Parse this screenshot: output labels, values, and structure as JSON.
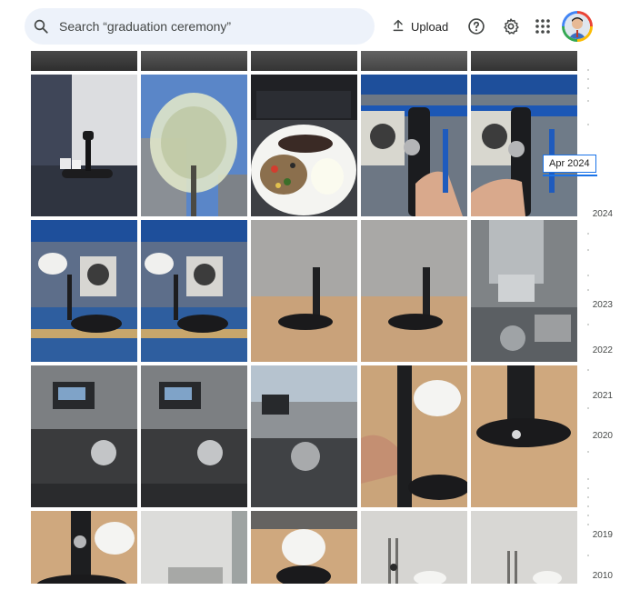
{
  "search": {
    "query": "Search “graduation ceremony”"
  },
  "toolbar": {
    "upload_label": "Upload"
  },
  "timeline": {
    "current_label": "Apr 2024",
    "years": [
      "2024",
      "2023",
      "2022",
      "2021",
      "2020",
      "2019",
      "2010"
    ]
  },
  "colors": {
    "accent": "#1a73e8",
    "search_bg": "#edf2fa"
  }
}
